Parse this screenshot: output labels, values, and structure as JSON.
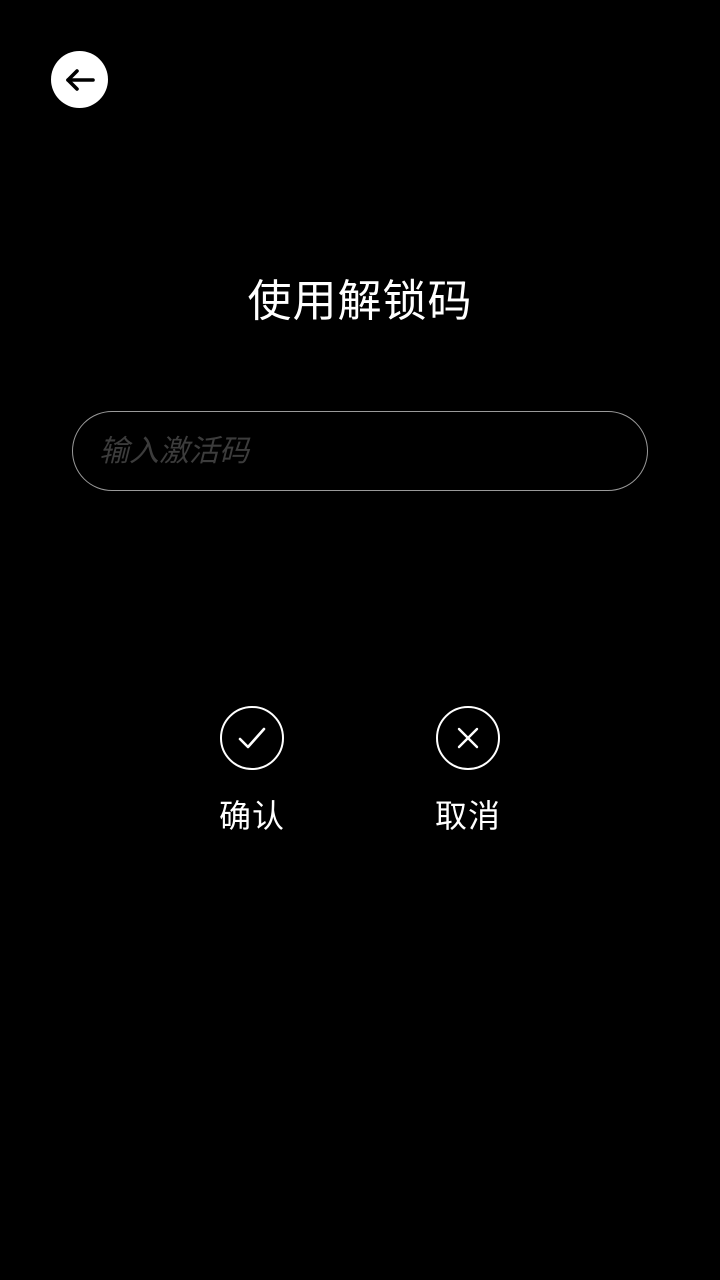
{
  "header": {
    "back_icon": "arrow-left-icon"
  },
  "main": {
    "title": "使用解锁码",
    "code_input": {
      "value": "",
      "placeholder": "输入激活码"
    }
  },
  "actions": {
    "confirm": {
      "icon": "check-icon",
      "label": "确认"
    },
    "cancel": {
      "icon": "close-icon",
      "label": "取消"
    }
  },
  "colors": {
    "background": "#000000",
    "text": "#ffffff",
    "input_border": "#9a9a9a",
    "placeholder": "#3c3c3c"
  }
}
